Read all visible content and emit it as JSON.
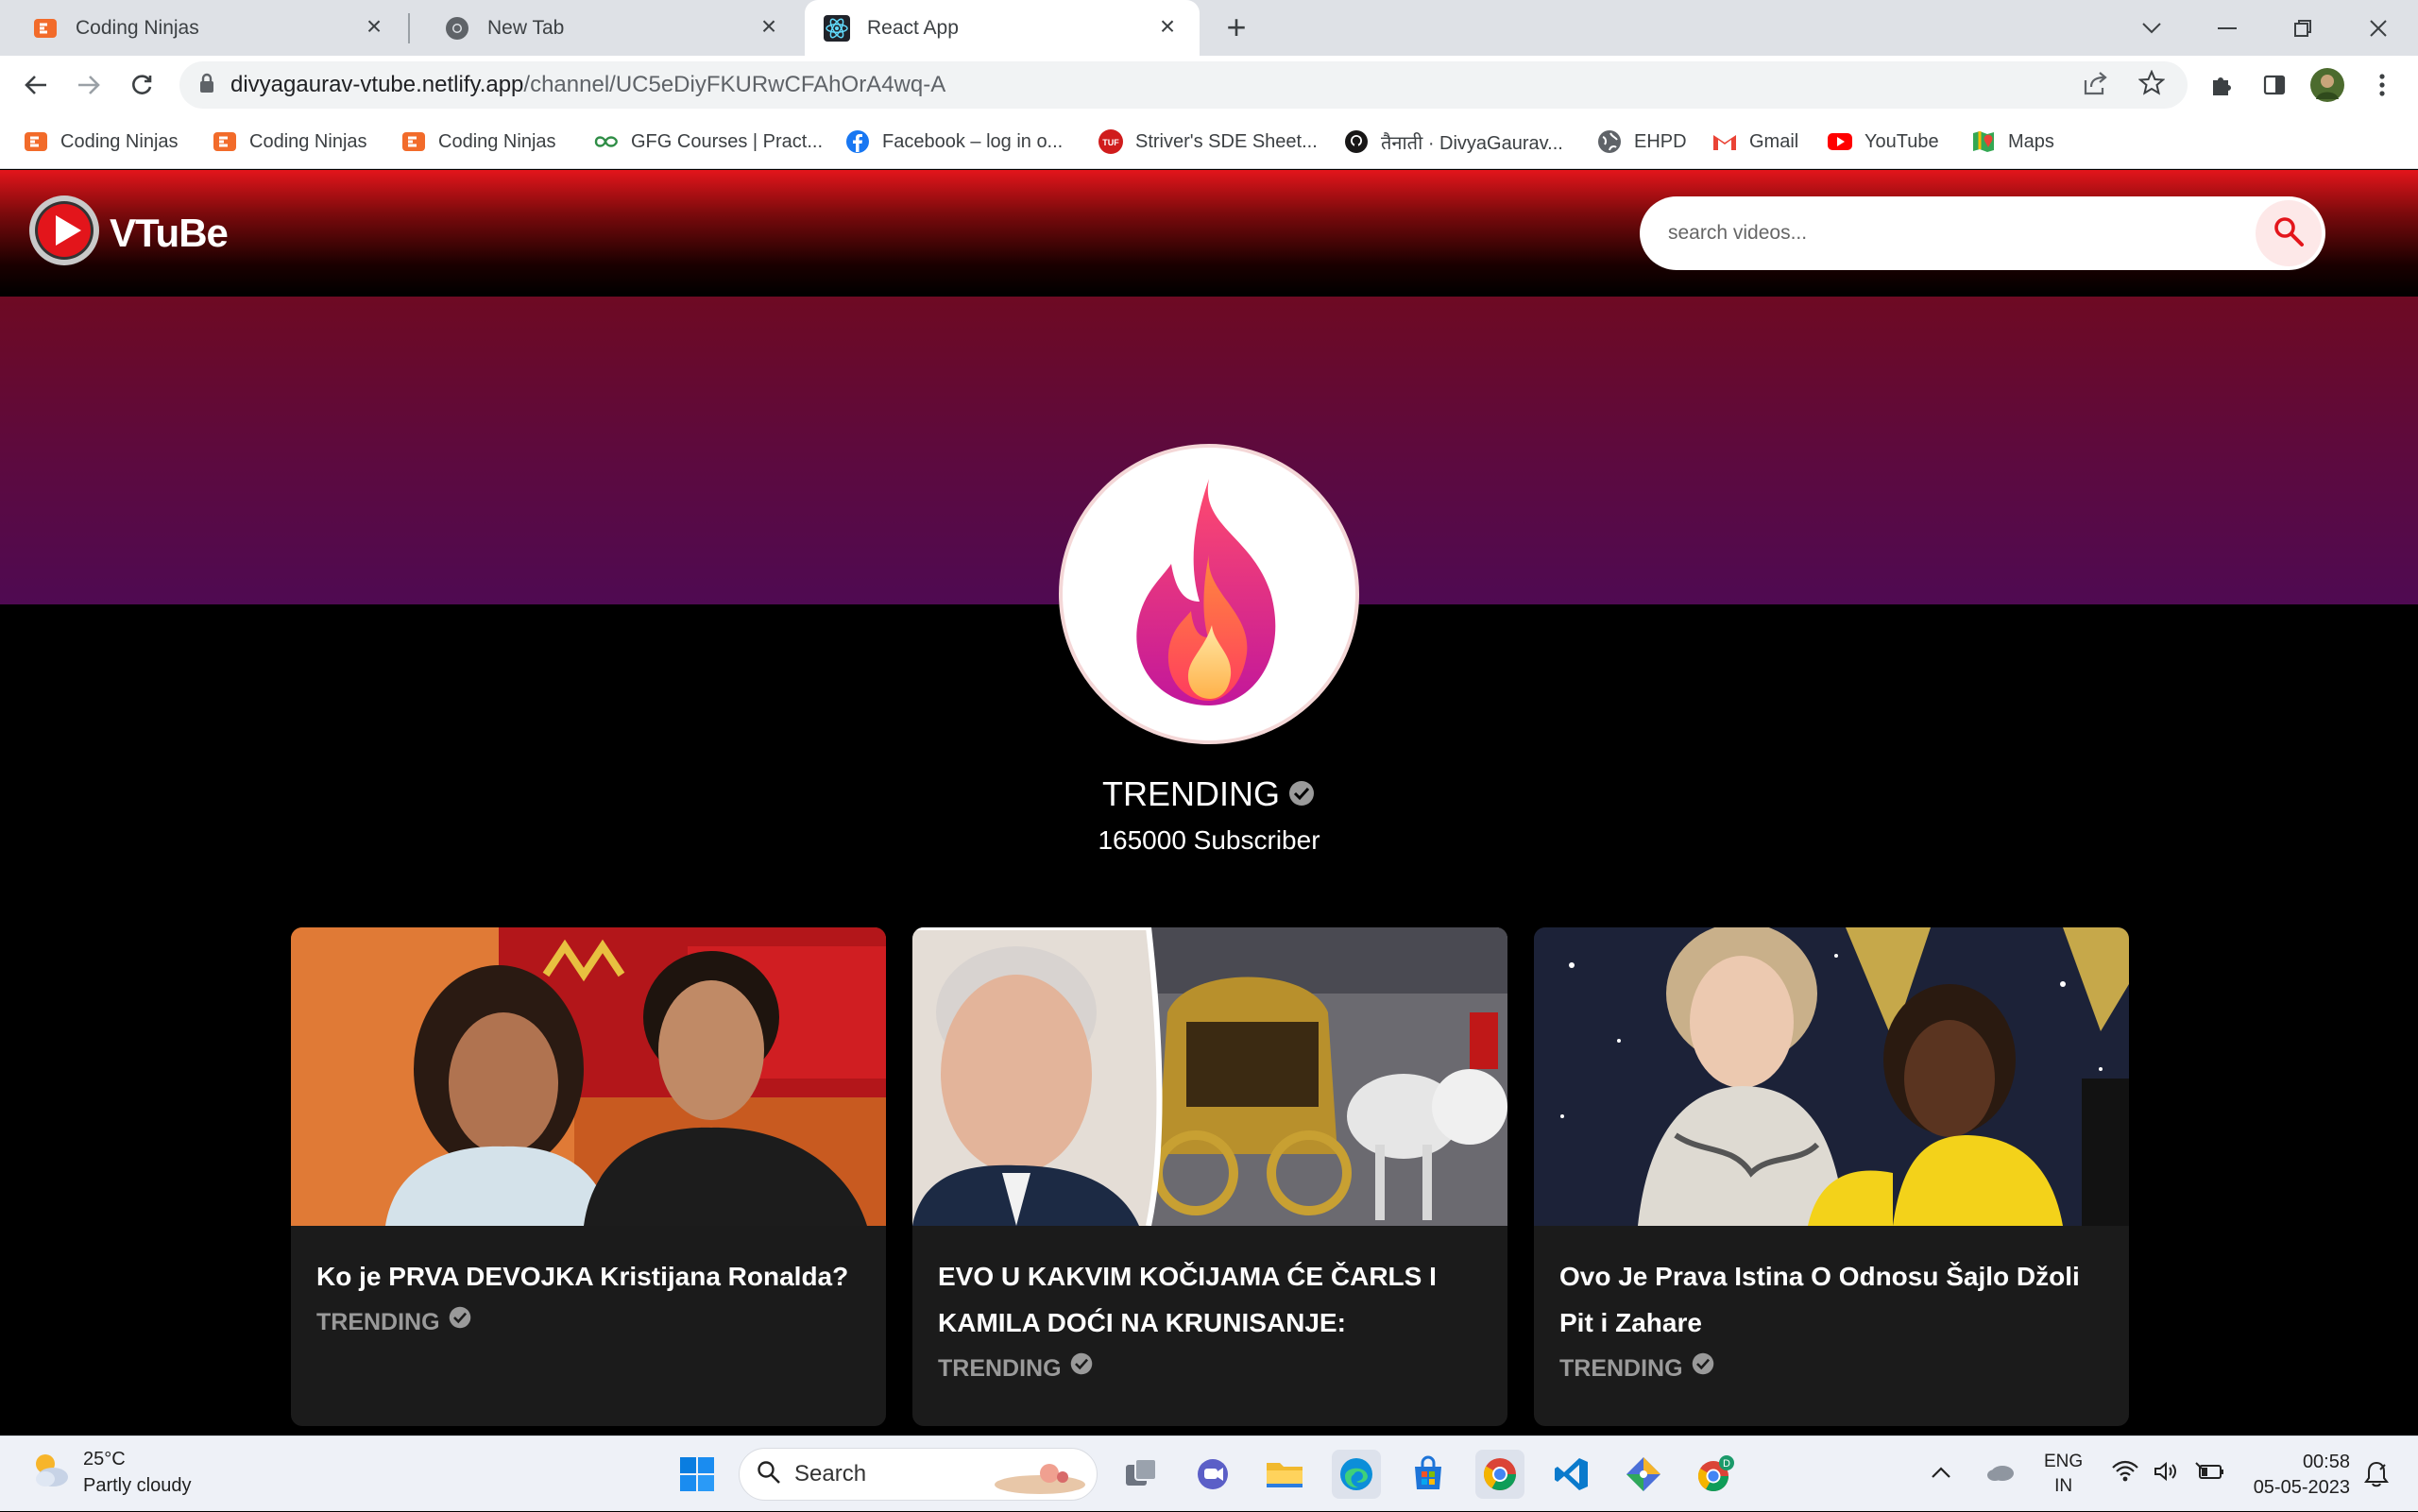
{
  "browser": {
    "tabs": [
      {
        "title": "Coding Ninjas",
        "icon": "coding-ninjas-icon",
        "active": false
      },
      {
        "title": "New Tab",
        "icon": "chrome-icon",
        "active": false
      },
      {
        "title": "React App",
        "icon": "react-icon",
        "active": true
      }
    ],
    "url_host": "divyagaurav-vtube.netlify.app",
    "url_path": "/channel/UC5eDiyFKURwCFAhOrA4wq-A",
    "bookmarks": [
      {
        "label": "Coding Ninjas",
        "icon": "coding-ninjas-icon"
      },
      {
        "label": "Coding Ninjas",
        "icon": "coding-ninjas-icon"
      },
      {
        "label": "Coding Ninjas",
        "icon": "coding-ninjas-icon"
      },
      {
        "label": "GFG Courses | Pract...",
        "icon": "gfg-icon"
      },
      {
        "label": "Facebook – log in o...",
        "icon": "facebook-icon"
      },
      {
        "label": "Striver's SDE Sheet...",
        "icon": "tuf-icon"
      },
      {
        "label": "तैनाती · DivyaGaurav...",
        "icon": "github-icon"
      },
      {
        "label": "EHPD",
        "icon": "globe-icon"
      },
      {
        "label": "Gmail",
        "icon": "gmail-icon"
      },
      {
        "label": "YouTube",
        "icon": "youtube-icon"
      },
      {
        "label": "Maps",
        "icon": "maps-icon"
      }
    ]
  },
  "app": {
    "logo_text": "VTuBe",
    "search_placeholder": "search videos..."
  },
  "channel": {
    "name": "TRENDING",
    "subscribers": "165000 Subscriber"
  },
  "videos": [
    {
      "title": "Ko je PRVA DEVOJKA Kristijana Ronalda?",
      "channel": "TRENDING"
    },
    {
      "title": "EVO U KAKVIM KOČIJAMA ĆE ČARLS I KAMILA DOĆI NA KRUNISANJE:",
      "channel": "TRENDING"
    },
    {
      "title": "Ovo Je Prava Istina O Odnosu Šajlo Džoli Pit i Zahare",
      "channel": "TRENDING"
    }
  ],
  "taskbar": {
    "weather_temp": "25°C",
    "weather_desc": "Partly cloudy",
    "search_label": "Search",
    "lang_1": "ENG",
    "lang_2": "IN",
    "time": "00:58",
    "date": "05-05-2023"
  },
  "colors": {
    "header_red": "#e3151b",
    "banner_purple": "#5c0a40",
    "card_bg": "#1b1b1b"
  }
}
